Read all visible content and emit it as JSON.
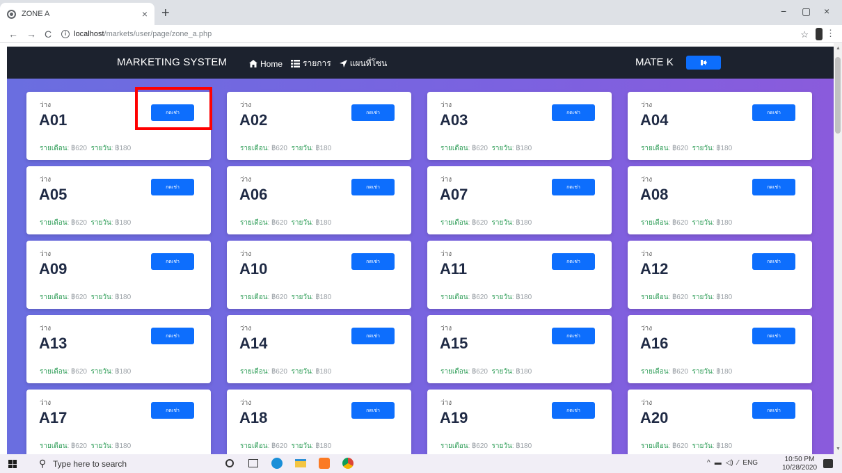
{
  "browser": {
    "tab_title": "ZONE A",
    "tab_close": "×",
    "new_tab": "+",
    "url_host": "localhost",
    "url_path": "/markets/user/page/zone_a.php",
    "back": "←",
    "forward": "→",
    "reload": "C",
    "star": "☆",
    "menu": "⋮",
    "minimize": "−",
    "maximize": "▢",
    "close": "×"
  },
  "nav": {
    "brand": "MARKETING SYSTEM",
    "links": [
      {
        "label": "Home",
        "icon": "home-icon"
      },
      {
        "label": "รายการ",
        "icon": "list-icon"
      },
      {
        "label": "แผนที่โซน",
        "icon": "location-arrow-icon"
      }
    ],
    "user": "MATE K",
    "logout_icon": "sign-out-icon"
  },
  "colors": {
    "primary": "#0d6efd",
    "nav_bg": "#1c222e",
    "price_label": "#2e9d57",
    "highlight": "#ff0000"
  },
  "stalls": [
    {
      "status": "ว่าง",
      "code": "A01",
      "button": "กดเช่า",
      "monthly_label": "รายเดือน",
      "monthly_value": ": ฿620",
      "daily_label": "รายวัน",
      "daily_value": ": ฿180"
    },
    {
      "status": "ว่าง",
      "code": "A02",
      "button": "กดเช่า",
      "monthly_label": "รายเดือน",
      "monthly_value": ": ฿620",
      "daily_label": "รายวัน",
      "daily_value": ": ฿180"
    },
    {
      "status": "ว่าง",
      "code": "A03",
      "button": "กดเช่า",
      "monthly_label": "รายเดือน",
      "monthly_value": ": ฿620",
      "daily_label": "รายวัน",
      "daily_value": ": ฿180"
    },
    {
      "status": "ว่าง",
      "code": "A04",
      "button": "กดเช่า",
      "monthly_label": "รายเดือน",
      "monthly_value": ": ฿620",
      "daily_label": "รายวัน",
      "daily_value": ": ฿180"
    },
    {
      "status": "ว่าง",
      "code": "A05",
      "button": "กดเช่า",
      "monthly_label": "รายเดือน",
      "monthly_value": ": ฿620",
      "daily_label": "รายวัน",
      "daily_value": ": ฿180"
    },
    {
      "status": "ว่าง",
      "code": "A06",
      "button": "กดเช่า",
      "monthly_label": "รายเดือน",
      "monthly_value": ": ฿620",
      "daily_label": "รายวัน",
      "daily_value": ": ฿180"
    },
    {
      "status": "ว่าง",
      "code": "A07",
      "button": "กดเช่า",
      "monthly_label": "รายเดือน",
      "monthly_value": ": ฿620",
      "daily_label": "รายวัน",
      "daily_value": ": ฿180"
    },
    {
      "status": "ว่าง",
      "code": "A08",
      "button": "กดเช่า",
      "monthly_label": "รายเดือน",
      "monthly_value": ": ฿620",
      "daily_label": "รายวัน",
      "daily_value": ": ฿180"
    },
    {
      "status": "ว่าง",
      "code": "A09",
      "button": "กดเช่า",
      "monthly_label": "รายเดือน",
      "monthly_value": ": ฿620",
      "daily_label": "รายวัน",
      "daily_value": ": ฿180"
    },
    {
      "status": "ว่าง",
      "code": "A10",
      "button": "กดเช่า",
      "monthly_label": "รายเดือน",
      "monthly_value": ": ฿620",
      "daily_label": "รายวัน",
      "daily_value": ": ฿180"
    },
    {
      "status": "ว่าง",
      "code": "A11",
      "button": "กดเช่า",
      "monthly_label": "รายเดือน",
      "monthly_value": ": ฿620",
      "daily_label": "รายวัน",
      "daily_value": ": ฿180"
    },
    {
      "status": "ว่าง",
      "code": "A12",
      "button": "กดเช่า",
      "monthly_label": "รายเดือน",
      "monthly_value": ": ฿620",
      "daily_label": "รายวัน",
      "daily_value": ": ฿180"
    },
    {
      "status": "ว่าง",
      "code": "A13",
      "button": "กดเช่า",
      "monthly_label": "รายเดือน",
      "monthly_value": ": ฿620",
      "daily_label": "รายวัน",
      "daily_value": ": ฿180"
    },
    {
      "status": "ว่าง",
      "code": "A14",
      "button": "กดเช่า",
      "monthly_label": "รายเดือน",
      "monthly_value": ": ฿620",
      "daily_label": "รายวัน",
      "daily_value": ": ฿180"
    },
    {
      "status": "ว่าง",
      "code": "A15",
      "button": "กดเช่า",
      "monthly_label": "รายเดือน",
      "monthly_value": ": ฿620",
      "daily_label": "รายวัน",
      "daily_value": ": ฿180"
    },
    {
      "status": "ว่าง",
      "code": "A16",
      "button": "กดเช่า",
      "monthly_label": "รายเดือน",
      "monthly_value": ": ฿620",
      "daily_label": "รายวัน",
      "daily_value": ": ฿180"
    },
    {
      "status": "ว่าง",
      "code": "A17",
      "button": "กดเช่า",
      "monthly_label": "รายเดือน",
      "monthly_value": ": ฿620",
      "daily_label": "รายวัน",
      "daily_value": ": ฿180"
    },
    {
      "status": "ว่าง",
      "code": "A18",
      "button": "กดเช่า",
      "monthly_label": "รายเดือน",
      "monthly_value": ": ฿620",
      "daily_label": "รายวัน",
      "daily_value": ": ฿180"
    },
    {
      "status": "ว่าง",
      "code": "A19",
      "button": "กดเช่า",
      "monthly_label": "รายเดือน",
      "monthly_value": ": ฿620",
      "daily_label": "รายวัน",
      "daily_value": ": ฿180"
    },
    {
      "status": "ว่าง",
      "code": "A20",
      "button": "กดเช่า",
      "monthly_label": "รายเดือน",
      "monthly_value": ": ฿620",
      "daily_label": "รายวัน",
      "daily_value": ": ฿180"
    }
  ],
  "taskbar": {
    "search_placeholder": "Type here to search",
    "language": "ENG",
    "time": "10:50 PM",
    "date": "10/28/2020"
  }
}
